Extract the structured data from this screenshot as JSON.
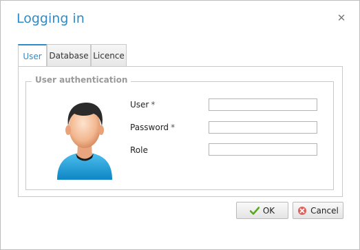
{
  "dialog": {
    "title": "Logging in"
  },
  "tabs": [
    {
      "label": "User",
      "active": true
    },
    {
      "label": "Database",
      "active": false
    },
    {
      "label": "Licence",
      "active": false
    }
  ],
  "group": {
    "legend": "User authentication"
  },
  "form": {
    "user_label": "User",
    "password_label": "Password",
    "role_label": "Role",
    "required_marker": "*",
    "user_value": "",
    "password_value": "",
    "role_value": ""
  },
  "buttons": {
    "ok_label": "OK",
    "cancel_label": "Cancel"
  },
  "icons": {
    "close": "close-icon",
    "ok": "checkmark-icon",
    "cancel": "cancel-icon",
    "avatar": "user-avatar-icon"
  },
  "colors": {
    "accent": "#2e8bc9",
    "ok_icon": "#5aa61f",
    "cancel_icon": "#d9534f",
    "shirt": "#1fa3df"
  }
}
